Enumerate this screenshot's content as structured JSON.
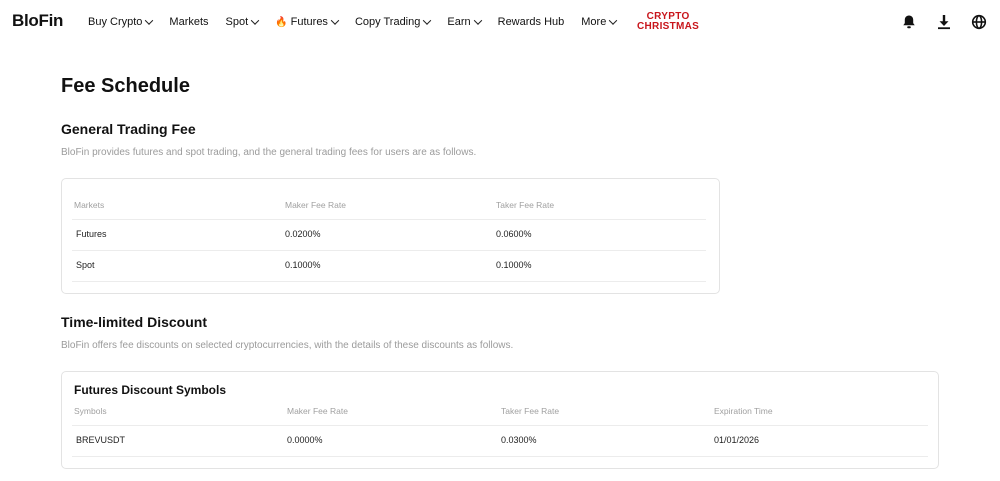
{
  "nav": {
    "logo": "BloFin",
    "items": [
      {
        "label": "Buy Crypto",
        "dropdown": true
      },
      {
        "label": "Markets",
        "dropdown": false
      },
      {
        "label": "Spot",
        "dropdown": true
      },
      {
        "label": "Futures",
        "dropdown": true,
        "icon": "fire-icon"
      },
      {
        "label": "Copy Trading",
        "dropdown": true
      },
      {
        "label": "Earn",
        "dropdown": true
      },
      {
        "label": "Rewards Hub",
        "dropdown": false
      },
      {
        "label": "More",
        "dropdown": true
      }
    ],
    "promo_line1": "CRYPTO",
    "promo_line2": "CHRISTMAS",
    "icons": [
      "bell-icon",
      "download-icon",
      "globe-icon"
    ]
  },
  "page": {
    "title": "Fee Schedule"
  },
  "general": {
    "title": "General Trading Fee",
    "description": "BloFin provides futures and spot trading, and the general trading fees for users are as follows.",
    "headers": [
      "Markets",
      "Maker Fee Rate",
      "Taker Fee Rate"
    ],
    "rows": [
      [
        "Futures",
        "0.0200%",
        "0.0600%"
      ],
      [
        "Spot",
        "0.1000%",
        "0.1000%"
      ]
    ]
  },
  "discount": {
    "title": "Time-limited Discount",
    "description": "BloFin offers fee discounts on selected cryptocurrencies, with the details of these discounts as follows.",
    "card_title": "Futures Discount Symbols",
    "headers": [
      "Symbols",
      "Maker Fee Rate",
      "Taker Fee Rate",
      "Expiration Time"
    ],
    "rows": [
      [
        "BREVUSDT",
        "0.0000%",
        "0.0300%",
        "01/01/2026"
      ]
    ]
  },
  "colors": {
    "promo": "#c8151b",
    "fire": "#f2a21a",
    "muted": "#9b9b9b"
  }
}
